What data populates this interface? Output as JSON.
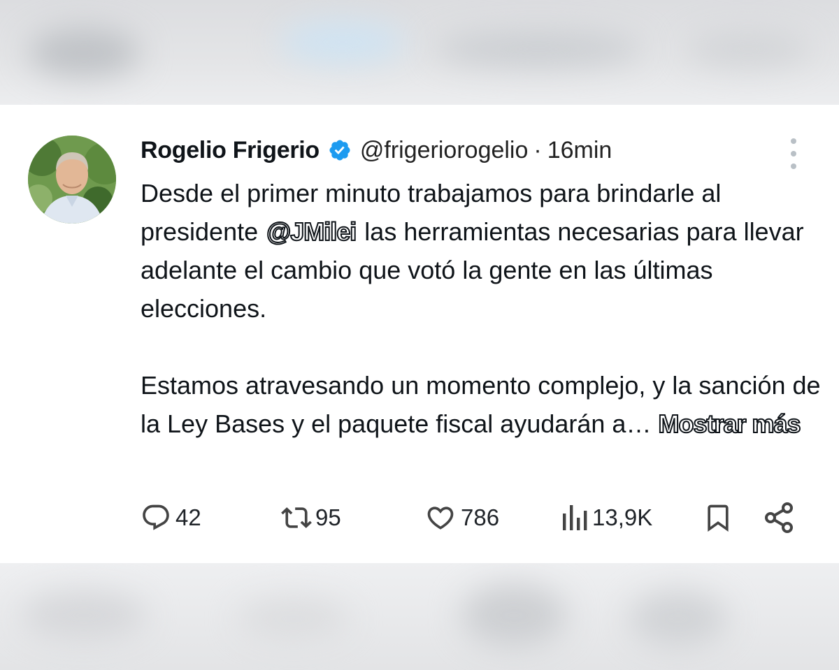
{
  "tweet": {
    "author": {
      "display_name": "Rogelio Frigerio",
      "handle": "@frigeriorogelio",
      "verified": true
    },
    "separator": "·",
    "time": "16min",
    "body": {
      "p1_start": "Desde el primer minuto trabajamos para brindarle al presidente",
      "mention": "@JMilei",
      "p1_end": "las herramientas necesarias para llevar adelante el cambio que votó la gente en las últimas elecciones.",
      "p2": "Estamos atravesando un momento complejo, y la sanción de la Ley Bases y el paquete fiscal ayudarán a…",
      "show_more": "Mostrar más"
    },
    "actions": {
      "replies": "42",
      "retweets": "95",
      "likes": "786",
      "views": "13,9K"
    }
  },
  "icons": {
    "verified": "verified-badge-icon",
    "more": "more-vertical-icon",
    "reply": "reply-icon",
    "retweet": "retweet-icon",
    "like": "heart-icon",
    "views": "views-icon",
    "bookmark": "bookmark-icon",
    "share": "share-icon"
  },
  "colors": {
    "verified_blue": "#1d9bf0",
    "text": "#0f1419",
    "card_bg": "#ffffff"
  }
}
